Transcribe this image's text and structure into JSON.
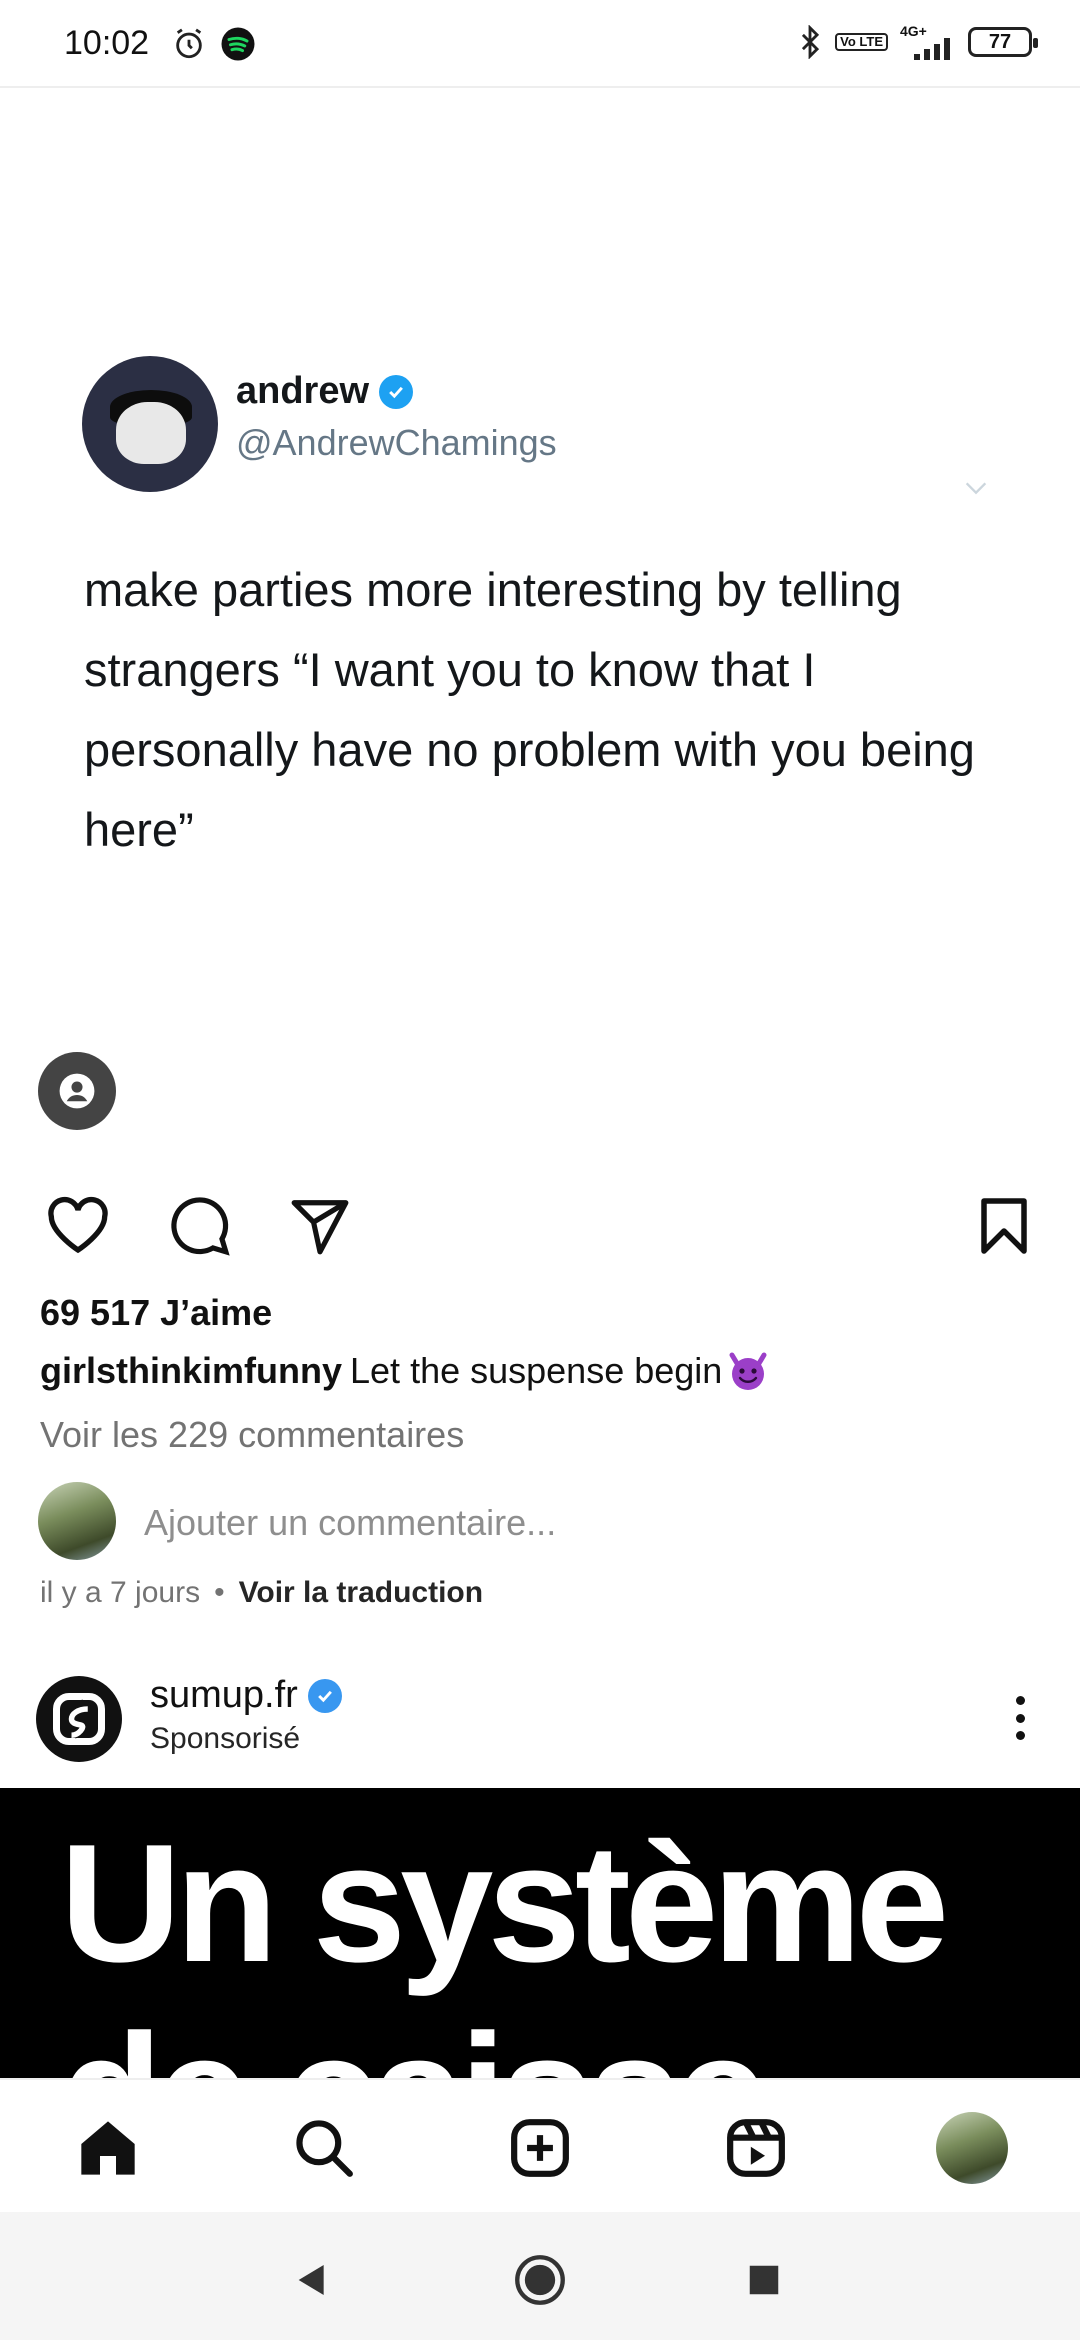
{
  "status_bar": {
    "time": "10:02",
    "battery": "77",
    "network": "4G+",
    "volte": "Vo LTE",
    "icons": [
      "alarm-icon",
      "spotify-icon",
      "bluetooth-icon",
      "signal-icon",
      "battery-icon"
    ]
  },
  "post": {
    "tweet": {
      "name": "andrew",
      "handle": "@AndrewChamings",
      "text": "make parties more interesting by telling strangers “I want you to know that I personally have no problem with you being here”"
    },
    "likes": "69 517 J’aime",
    "caption_user": "girlsthinkimfunny",
    "caption_text": "Let the suspense begin",
    "view_comments": "Voir les 229 commentaires",
    "add_comment_placeholder": "Ajouter un commentaire...",
    "time_ago": "il y a 7 jours",
    "separator": "•",
    "translate": "Voir la traduction"
  },
  "sponsored": {
    "account": "sumup.fr",
    "label": "Sponsorisé",
    "ad_line1": "Un système",
    "ad_line2": "de caisse"
  },
  "colors": {
    "twitter_blue": "#1da1f2",
    "instagram_verified": "#3897f0",
    "muted_text": "#737373"
  }
}
